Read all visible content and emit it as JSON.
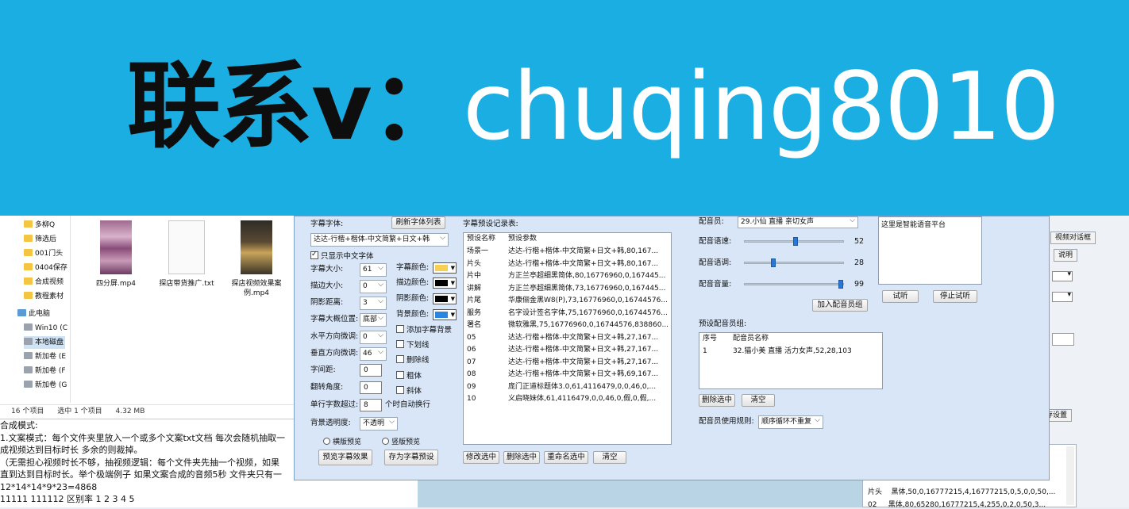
{
  "banner": {
    "prefix": "联系v：",
    "contact_id": "chuqing8010"
  },
  "explorer": {
    "nav": [
      {
        "label": "多柳Q",
        "icon": "folder-icon"
      },
      {
        "label": "筛选后",
        "icon": "folder-icon"
      },
      {
        "label": "001门头",
        "icon": "folder-icon"
      },
      {
        "label": "0404保存",
        "icon": "folder-icon"
      },
      {
        "label": "合成视频",
        "icon": "folder-icon"
      },
      {
        "label": "教程素材",
        "icon": "folder-icon"
      },
      {
        "label": "此电脑",
        "icon": "pc-icon"
      },
      {
        "label": "Win10 (C",
        "icon": "drive-icon"
      },
      {
        "label": "本地磁盘",
        "icon": "drive-icon"
      },
      {
        "label": "新加卷 (E",
        "icon": "drive-icon"
      },
      {
        "label": "新加卷 (F",
        "icon": "drive-icon"
      },
      {
        "label": "新加卷 (G",
        "icon": "drive-icon"
      }
    ],
    "files": [
      {
        "name": "四分屏.mp4",
        "kind": "video"
      },
      {
        "name": "探店带货推广.txt",
        "kind": "text"
      },
      {
        "name": "探店视频效果案例.mp4",
        "kind": "video"
      }
    ],
    "status": {
      "count": "16 个项目",
      "selected": "选中 1 个项目",
      "size": "4.32 MB"
    }
  },
  "notes": {
    "lines": [
      "合成模式:",
      "1.文案模式：每个文件夹里放入一个或多个文案txt文档 每次会随机抽取一",
      "成视频达到目标时长 多余的则裁掉。",
      "（无需担心视频时长不够，抽视频逻辑：每个文件夹先抽一个视频，如果",
      "直到达到目标时长。举个极端例子 如果文案合成的音频5秒 文件夹只有一",
      "12*14*14*9*23=4868",
      "11111  111112 区别率  1 2 3 4 5"
    ]
  },
  "right_window": {
    "buttons": {
      "video_frame": "视频对话框",
      "explain": "说明",
      "save_settings": "存设置"
    },
    "table_rows": [
      {
        "name": "片头",
        "value": "黑体,50,0,16777215,4,16777215,0,5,0,0,50,..."
      },
      {
        "name": "02",
        "value": "黑体,80,65280,16777215,4,255,0,2,0,50,3..."
      }
    ]
  },
  "dialog": {
    "font": {
      "label": "字幕字体:",
      "refresh_button": "刷新字体列表",
      "selected_font": "达达-行楷+楷体-中文简繁+日文+韩",
      "only_chinese": "只显示中文字体",
      "only_chinese_checked": true
    },
    "fields": {
      "size": {
        "label": "字幕大小:",
        "value": "61"
      },
      "stroke_size": {
        "label": "描边大小:",
        "value": "0"
      },
      "shadow_distance": {
        "label": "阴影距离:",
        "value": "3"
      },
      "position": {
        "label": "字幕大概位置:",
        "value": "底部"
      },
      "h_offset": {
        "label": "水平方向微调:",
        "value": "0"
      },
      "v_offset": {
        "label": "垂直方向微调:",
        "value": "46"
      },
      "spacing": {
        "label": "字间距:",
        "value": "0"
      },
      "rotate": {
        "label": "翻转角度:",
        "value": "0"
      },
      "wrap": {
        "label": "单行字数超过:",
        "value": "8",
        "suffix": "个时自动换行"
      },
      "opacity": {
        "label": "背景透明度:",
        "value": "不透明"
      }
    },
    "colors": {
      "text": {
        "label": "字幕颜色:",
        "hex": "#f7cf53"
      },
      "stroke": {
        "label": "描边颜色:",
        "hex": "#000000"
      },
      "shadow": {
        "label": "阴影颜色:",
        "hex": "#000000"
      },
      "background": {
        "label": "背景颜色:",
        "hex": "#2b86e0"
      }
    },
    "options": {
      "add_bg": "添加字幕背景",
      "underline": "下划线",
      "strikethrough": "删除线",
      "bold": "粗体",
      "italic": "斜体"
    },
    "preview_mode": {
      "horizontal": "横版预览",
      "vertical": "竖版预览"
    },
    "buttons": {
      "preview": "预览字幕效果",
      "save_preset": "存为字幕预设",
      "edit_selected": "修改选中",
      "delete_selected": "删除选中",
      "rename_selected": "重命名选中",
      "clear": "清空"
    },
    "presets": {
      "title": "字幕预设记录表:",
      "col_name": "预设名称",
      "col_params": "预设参数",
      "rows": [
        {
          "name": "场景一",
          "params": "达达-行楷+楷体-中文简繁+日文+韩,80,167..."
        },
        {
          "name": "片头",
          "params": "达达-行楷+楷体-中文简繁+日文+韩,80,167..."
        },
        {
          "name": "片中",
          "params": "方正兰亭超细黑简体,80,16776960,0,167445..."
        },
        {
          "name": "讲解",
          "params": "方正兰亭超细黑简体,73,16776960,0,167445..."
        },
        {
          "name": "片尾",
          "params": "华康俪金黑W8(P),73,16776960,0,16744576..."
        },
        {
          "name": "服务",
          "params": "名字设计签名字体,75,16776960,0,16744576..."
        },
        {
          "name": "署名",
          "params": "微软雅黑,75,16776960,0,16744576,838860..."
        },
        {
          "name": "05",
          "params": "达达-行楷+楷体-中文简繁+日文+韩,27,167..."
        },
        {
          "name": "06",
          "params": "达达-行楷+楷体-中文简繁+日文+韩,27,167..."
        },
        {
          "name": "07",
          "params": "达达-行楷+楷体-中文简繁+日文+韩,27,167..."
        },
        {
          "name": "08",
          "params": "达达-行楷+楷体-中文简繁+日文+韩,69,167..."
        },
        {
          "name": "09",
          "params": "庞门正道标题体3.0,61,4116479,0,0,46,0,..."
        },
        {
          "name": "10",
          "params": "义启晓妹体,61,4116479,0,0,46,0,假,0,假,..."
        }
      ]
    },
    "voice": {
      "actor_label": "配音员:",
      "actor_value": "29.小仙 直播 亲切女声",
      "speed_label": "配音语速:",
      "speed": 52,
      "pitch_label": "配音语调:",
      "pitch": 28,
      "volume_label": "配音音量:",
      "volume": 99,
      "sample_text": "这里是智能语音平台",
      "listen": "试听",
      "stop_listen": "停止试听",
      "add_group": "加入配音员组",
      "group_title": "预设配音员组:",
      "group_col_index": "序号",
      "group_col_name": "配音员名称",
      "group_rows": [
        {
          "index": "1",
          "name": "32.猫小美 直播 活力女声,52,28,103"
        }
      ],
      "delete_selected": "删除选中",
      "clear": "清空",
      "rule_label": "配音员使用规则:",
      "rule_value": "顺序循环不重复"
    }
  }
}
